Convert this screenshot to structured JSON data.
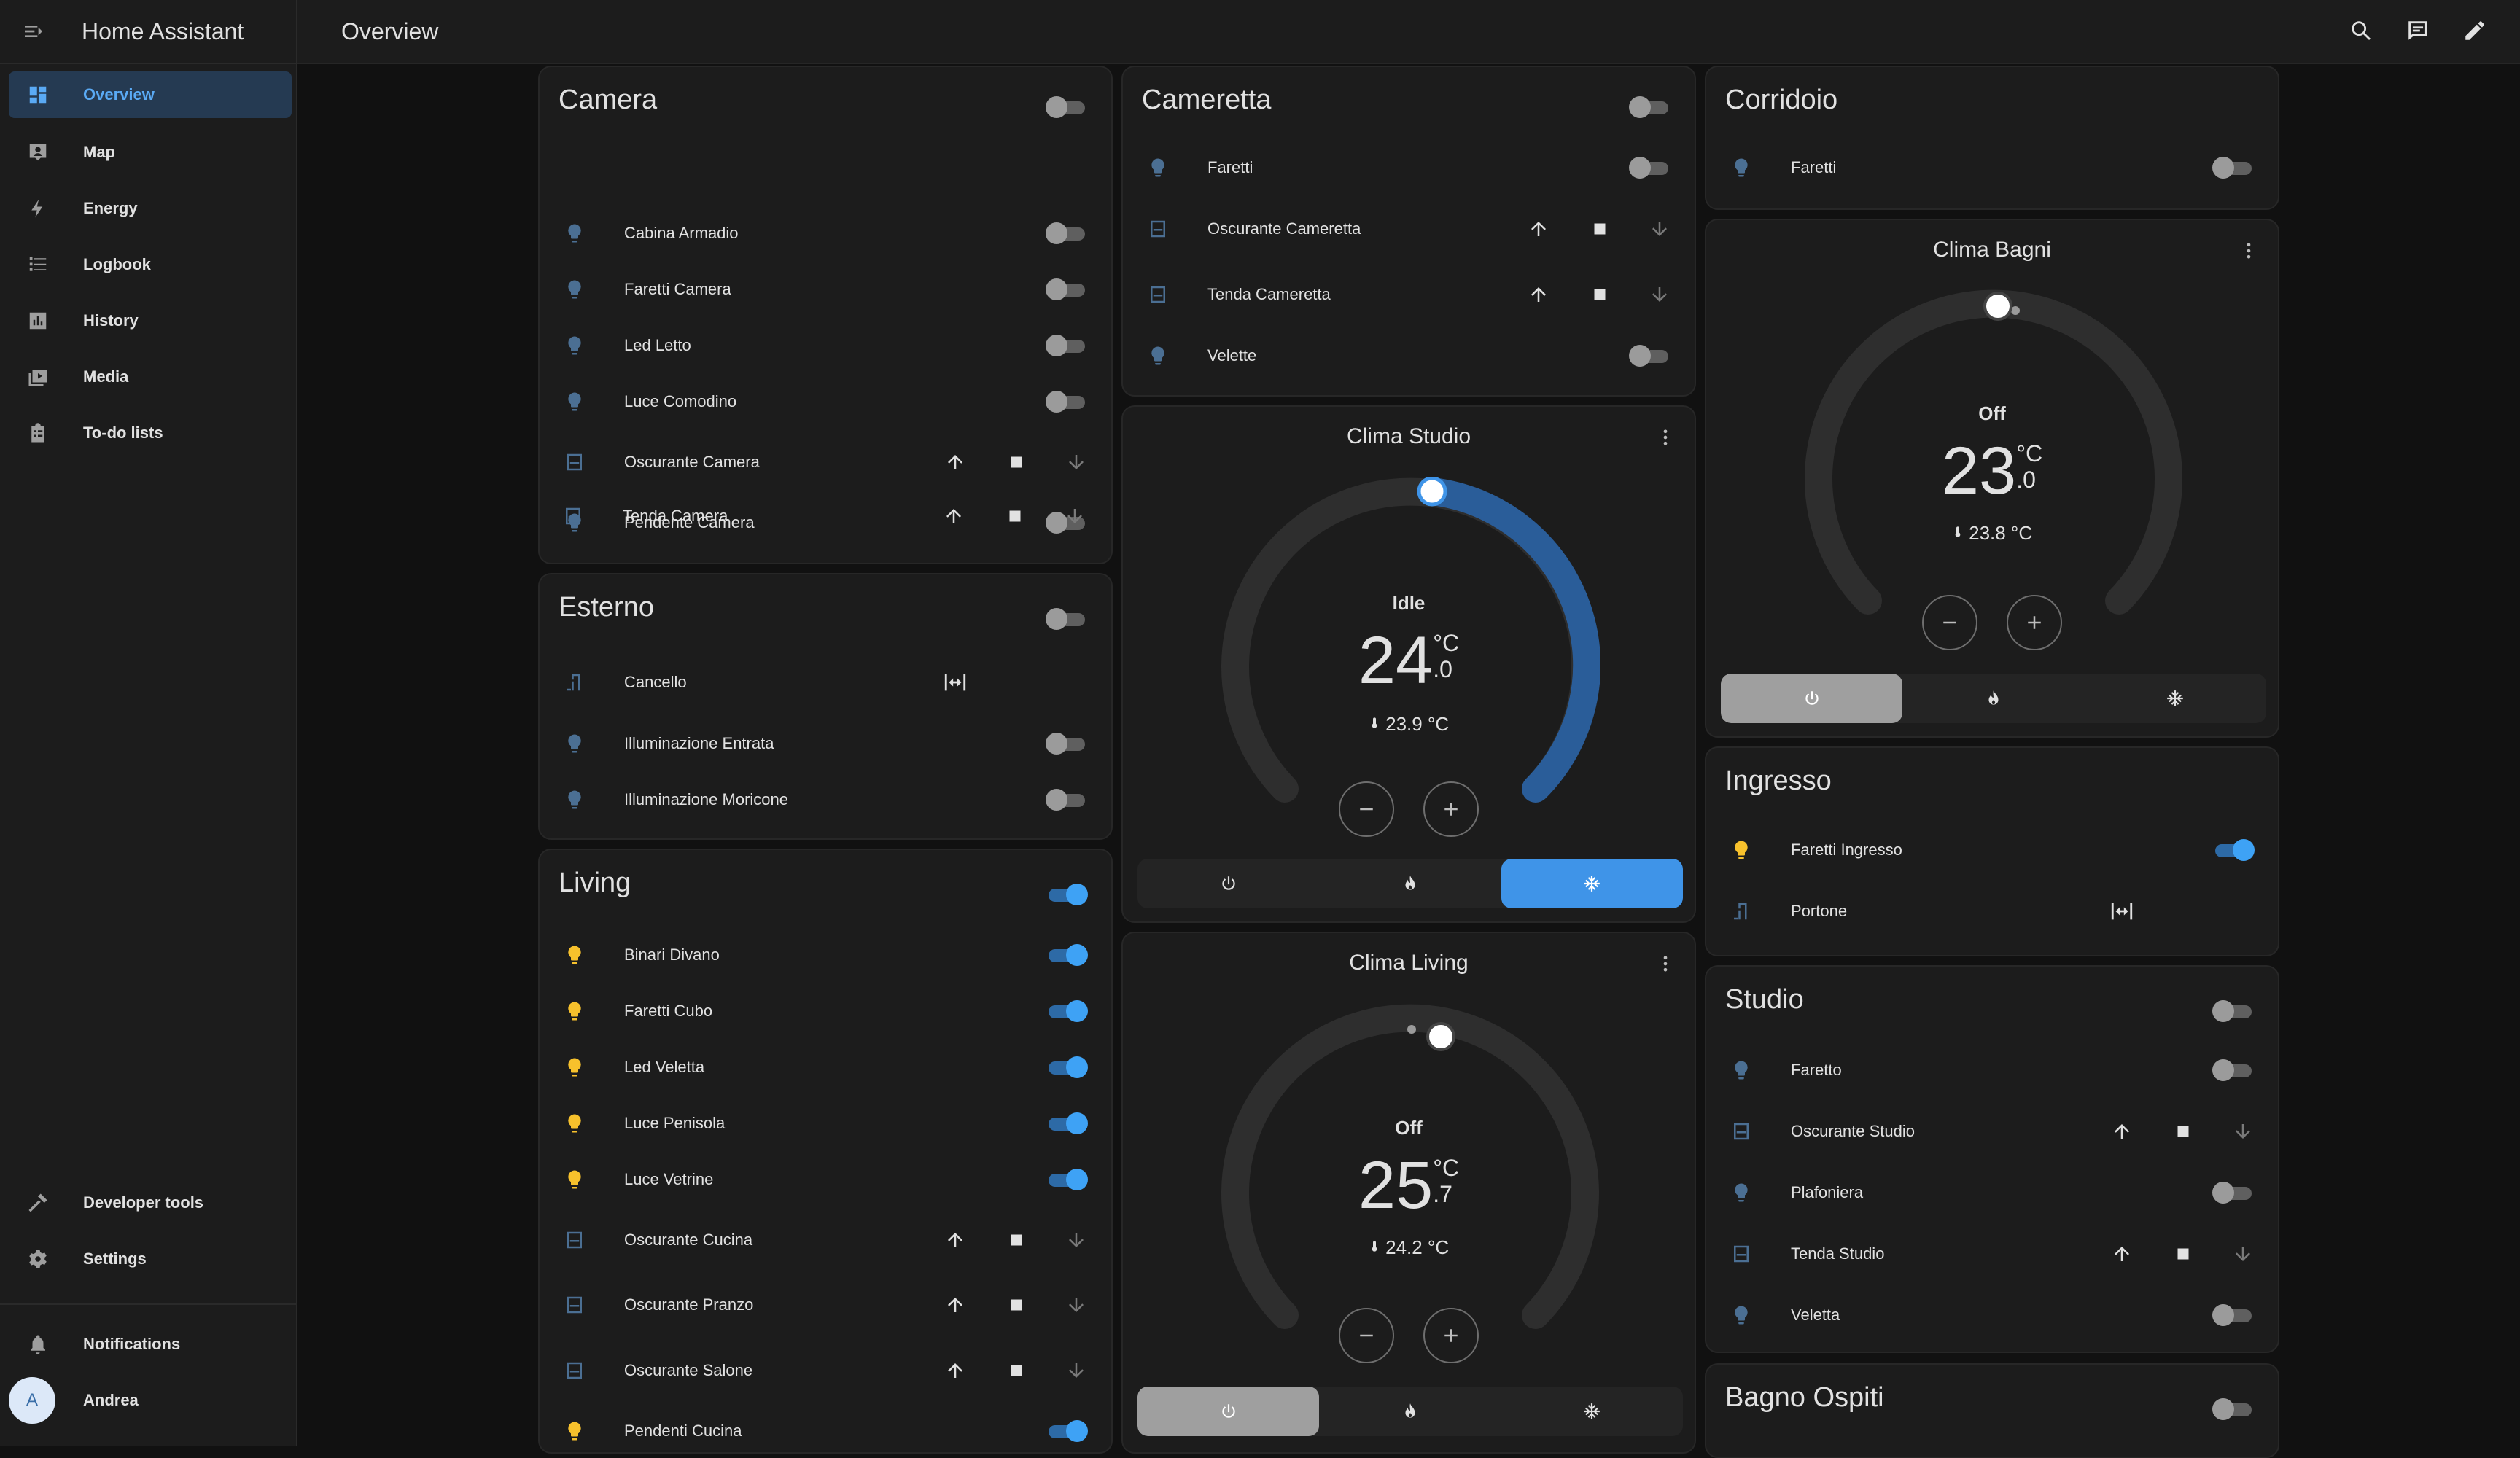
{
  "app": {
    "title": "Home Assistant"
  },
  "topbar": {
    "title": "Overview"
  },
  "sidebar": {
    "items": [
      {
        "label": "Overview"
      },
      {
        "label": "Map"
      },
      {
        "label": "Energy"
      },
      {
        "label": "Logbook"
      },
      {
        "label": "History"
      },
      {
        "label": "Media"
      },
      {
        "label": "To-do lists"
      }
    ],
    "developer_tools": "Developer tools",
    "settings": "Settings",
    "notifications": "Notifications",
    "user": {
      "initial": "A",
      "name": "Andrea"
    }
  },
  "colors": {
    "accent": "#3ea2f5",
    "bulb_on": "#f7c12c",
    "bulb_off": "#4b6f93",
    "card": "#1c1c1c",
    "background": "#111111"
  },
  "cards": {
    "camera": {
      "title": "Camera",
      "rows": [
        "Cabina Armadio",
        "Faretti Camera",
        "Led Letto",
        "Luce Comodino",
        "Oscurante Camera",
        "Pendente Camera",
        "Tenda Camera"
      ]
    },
    "esterno": {
      "title": "Esterno",
      "rows": [
        "Cancello",
        "Illuminazione Entrata",
        "Illuminazione Moricone"
      ]
    },
    "living": {
      "title": "Living",
      "rows": [
        "Binari Divano",
        "Faretti Cubo",
        "Led Veletta",
        "Luce Penisola",
        "Luce Vetrine",
        "Oscurante Cucina",
        "Oscurante Pranzo",
        "Oscurante Salone",
        "Pendenti Cucina"
      ]
    },
    "cameretta": {
      "title": "Cameretta",
      "rows": [
        "Faretti",
        "Oscurante Cameretta",
        "Tenda Cameretta",
        "Velette"
      ]
    },
    "corridoio": {
      "title": "Corridoio",
      "rows": [
        "Faretti"
      ]
    },
    "ingresso": {
      "title": "Ingresso",
      "rows": [
        "Faretti Ingresso",
        "Portone"
      ]
    },
    "studio": {
      "title": "Studio",
      "rows": [
        "Faretto",
        "Oscurante Studio",
        "Plafoniera",
        "Tenda Studio",
        "Veletta"
      ]
    },
    "bagno_ospiti": {
      "title": "Bagno Ospiti"
    }
  },
  "thermostats": {
    "studio": {
      "title": "Clima Studio",
      "state": "Idle",
      "target_int": "24",
      "target_dec": ".0",
      "unit": "°C",
      "current": "23.9 °C",
      "mode": "cool"
    },
    "living": {
      "title": "Clima Living",
      "state": "Off",
      "target_int": "25",
      "target_dec": ".7",
      "unit": "°C",
      "current": "24.2 °C",
      "mode": "off"
    },
    "bagni": {
      "title": "Clima Bagni",
      "state": "Off",
      "target_int": "23",
      "target_dec": ".0",
      "unit": "°C",
      "current": "23.8 °C",
      "mode": "off"
    }
  }
}
